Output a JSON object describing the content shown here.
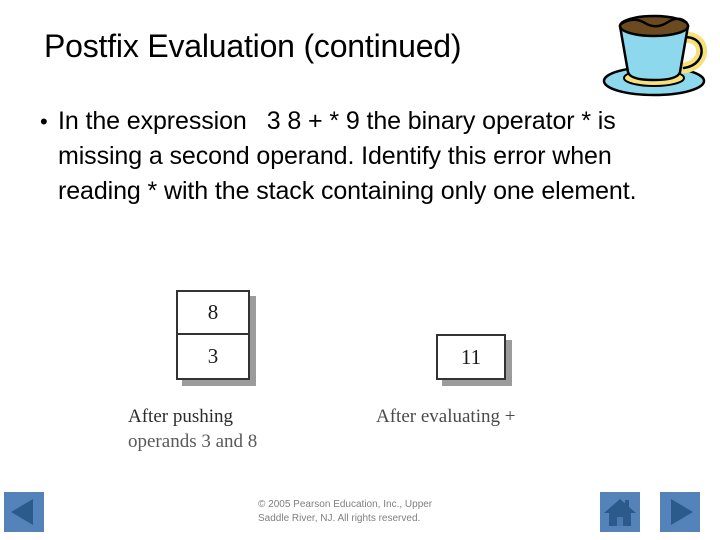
{
  "slide": {
    "title": "Postfix Evaluation (continued)",
    "bullet_marker": "•",
    "body": {
      "line_a": "In the expression",
      "expression": "3 8 + * 9",
      "line_b": "the binary",
      "line_c": "operator * is missing a second operand.",
      "line_d": "Identify this error when reading * with the",
      "line_e": "stack containing only one element."
    }
  },
  "diagram": {
    "stack_after_push": {
      "cells": [
        "8",
        "3"
      ],
      "caption_line1": "After pushing",
      "caption_line2": "operands 3 and 8"
    },
    "stack_after_eval": {
      "cells": [
        "11"
      ],
      "caption": "After evaluating +"
    }
  },
  "footer": {
    "copyright_line1": "© 2005 Pearson Education, Inc., Upper",
    "copyright_line2": "Saddle River, NJ.  All rights reserved."
  },
  "nav": {
    "prev_label": "Previous slide",
    "home_label": "Home",
    "next_label": "Next slide"
  },
  "colors": {
    "nav_button_bg": "#5383b8",
    "nav_glyph": "#2d5a8c",
    "cup_body": "#8ed8ed",
    "cup_accent": "#f5e07a",
    "coffee": "#6b4a20",
    "box_border": "#333333",
    "box_shadow": "#9b9b9b",
    "footer_text": "#808080"
  }
}
